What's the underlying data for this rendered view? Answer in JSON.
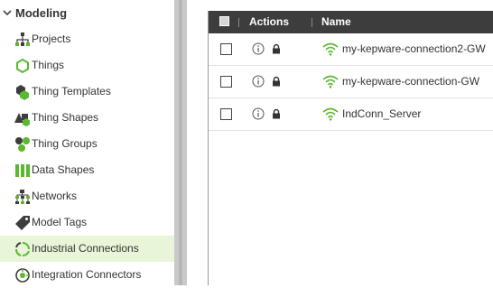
{
  "sidebar": {
    "section_title": "Modeling",
    "items": [
      {
        "label": "Projects",
        "icon": "projects-icon"
      },
      {
        "label": "Things",
        "icon": "things-icon"
      },
      {
        "label": "Thing Templates",
        "icon": "thing-templates-icon"
      },
      {
        "label": "Thing Shapes",
        "icon": "thing-shapes-icon"
      },
      {
        "label": "Thing Groups",
        "icon": "thing-groups-icon"
      },
      {
        "label": "Data Shapes",
        "icon": "data-shapes-icon"
      },
      {
        "label": "Networks",
        "icon": "networks-icon"
      },
      {
        "label": "Model Tags",
        "icon": "model-tags-icon"
      },
      {
        "label": "Industrial Connections",
        "icon": "industrial-connections-icon",
        "active": true
      },
      {
        "label": "Integration Connectors",
        "icon": "integration-connectors-icon"
      }
    ]
  },
  "grid": {
    "columns": {
      "actions": "Actions",
      "name": "Name"
    },
    "rows": [
      {
        "name": "my-kepware-connection2-GW"
      },
      {
        "name": "my-kepware-connection-GW"
      },
      {
        "name": "IndConn_Server"
      }
    ]
  },
  "colors": {
    "accent_green": "#5cb82e",
    "active_bg": "#e8f5d8",
    "header_bg": "#3d3d3d",
    "icon_dark": "#3d3d3d"
  }
}
